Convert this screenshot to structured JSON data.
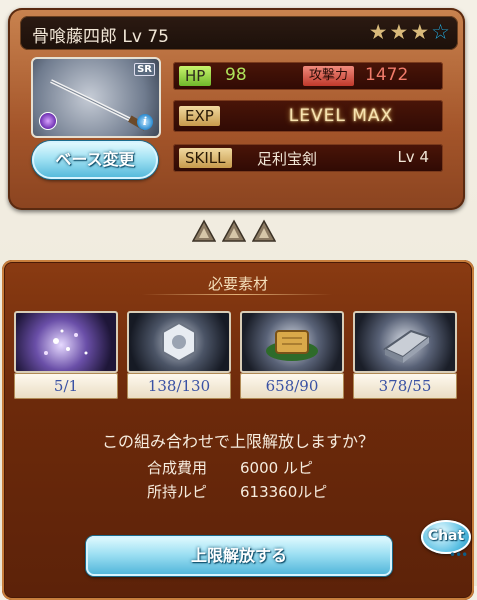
{
  "header": {
    "title": "骨喰藤四郎 Lv 75",
    "stars_filled": 3,
    "stars_total": 4
  },
  "weapon": {
    "rarity": "SR",
    "base_change_label": "ベース変更"
  },
  "stats": {
    "hp_label": "HP",
    "hp_value": "98",
    "atk_label": "攻撃力",
    "atk_value": "1472",
    "exp_label": "EXP",
    "exp_status": "LEVEL MAX",
    "skill_label": "SKILL",
    "skill_name": "足利宝剣",
    "skill_level": "Lv 4"
  },
  "materials": {
    "title": "必要素材",
    "items": [
      {
        "icon": "purple-sparkle-material-icon",
        "count": "5/1"
      },
      {
        "icon": "silver-crest-material-icon",
        "count": "138/130"
      },
      {
        "icon": "gold-scroll-material-icon",
        "count": "658/90"
      },
      {
        "icon": "silver-ingot-material-icon",
        "count": "378/55"
      }
    ]
  },
  "confirm": {
    "question": "この組み合わせで上限解放しますか？",
    "cost_label": "合成費用",
    "cost_value": "6000 ルピ",
    "owned_label": "所持ルピ",
    "owned_value": "613360ルピ",
    "button_label": "上限解放する"
  },
  "chat": {
    "label": "Chat",
    "dots": "•••"
  },
  "colors": {
    "card_brown": "#a4552a",
    "panel_brown": "#6d2a0b",
    "button_blue": "#4fb6d9",
    "count_blue": "#3a52a4",
    "hp_green": "#aee25a",
    "atk_red": "#f07b6a"
  }
}
